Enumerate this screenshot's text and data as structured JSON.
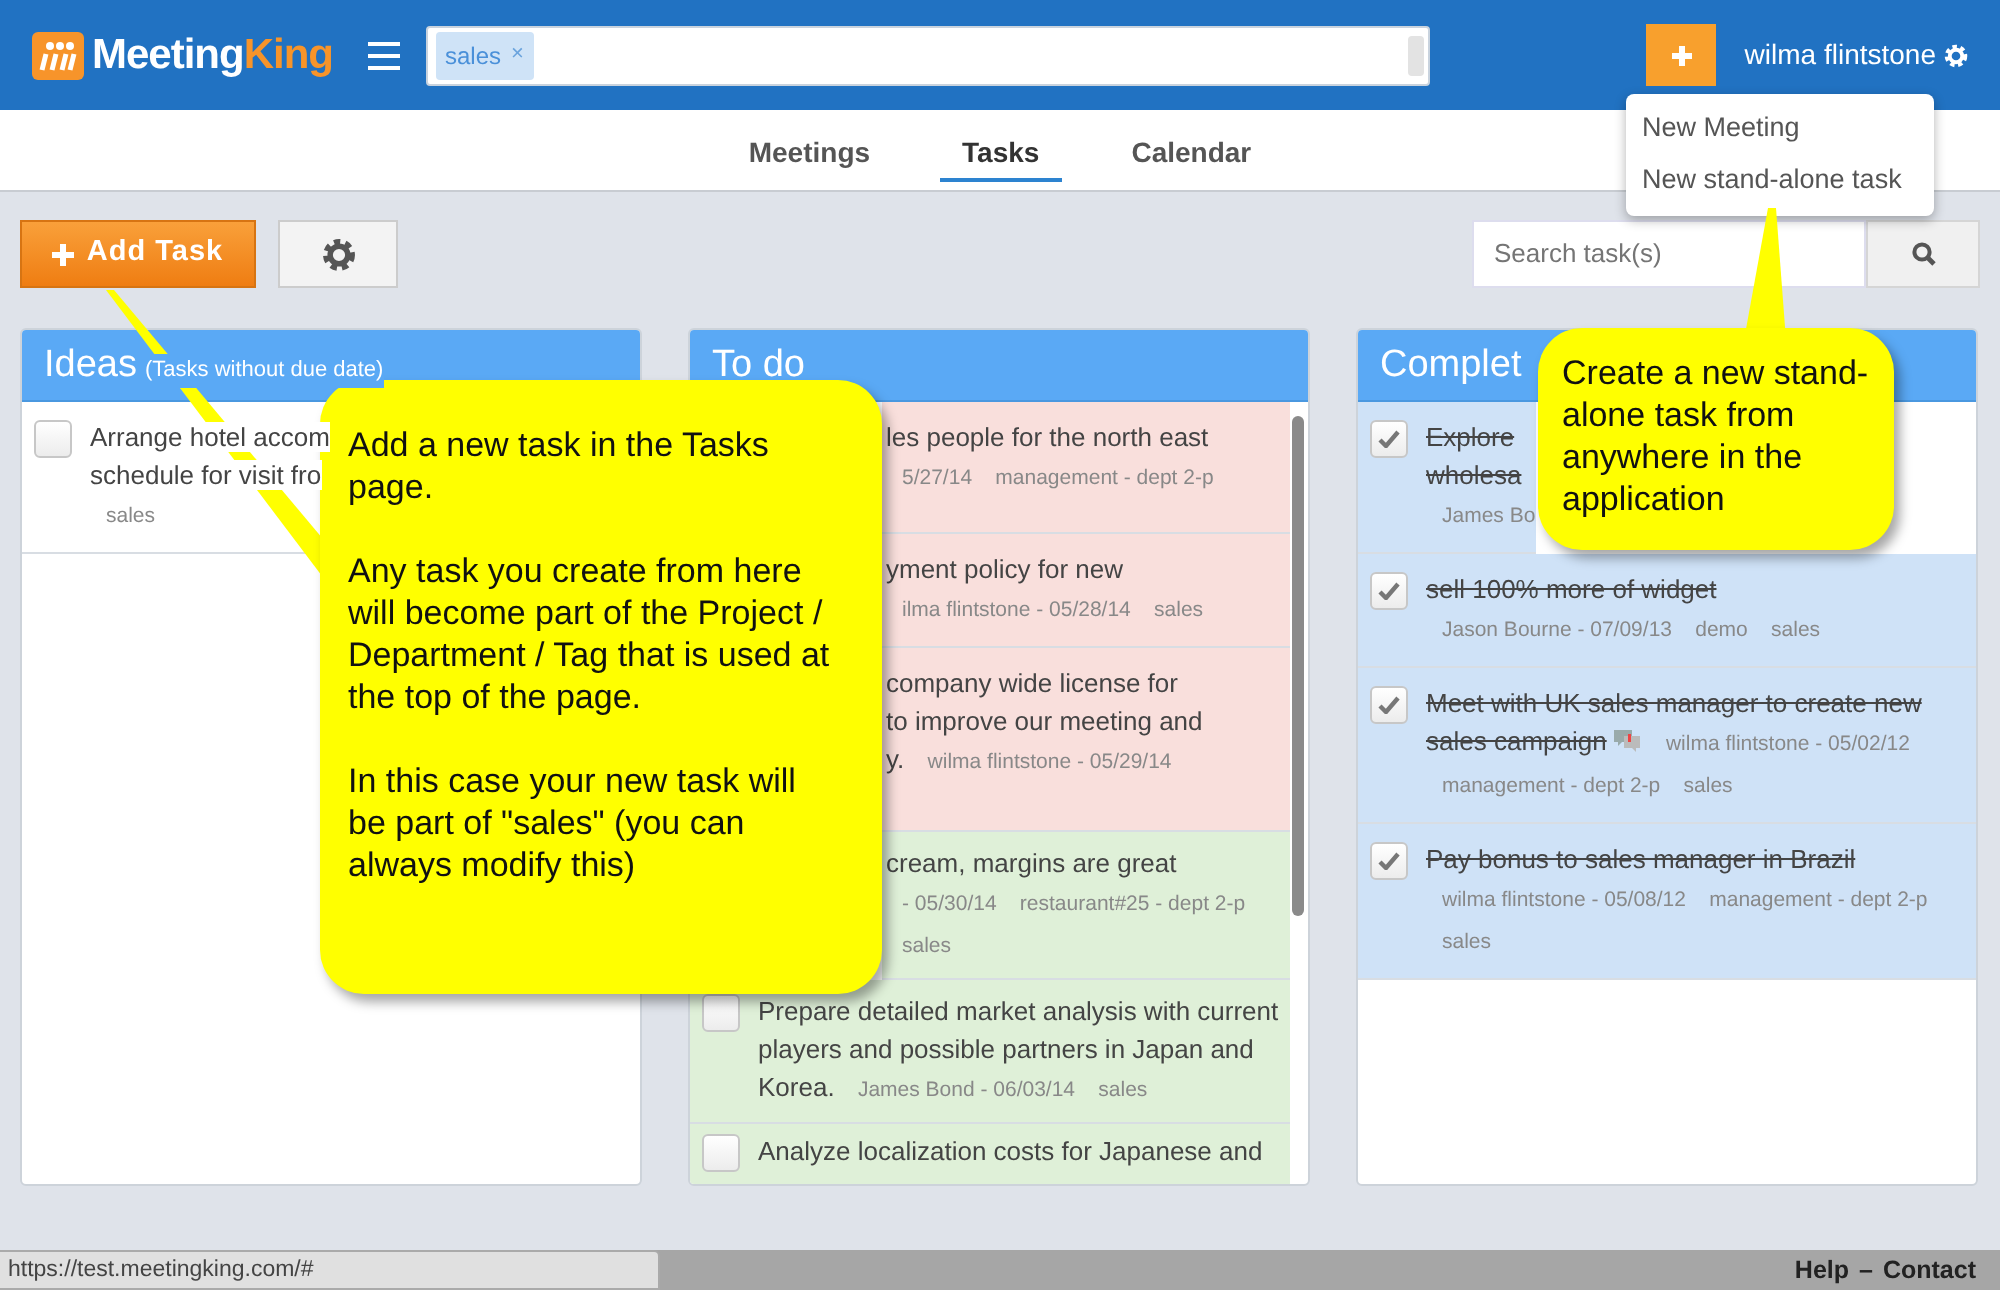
{
  "header": {
    "logo": {
      "part1": "Meeting",
      "part2": "King"
    },
    "tag_filter": {
      "tags": [
        {
          "label": "sales",
          "remove": "×"
        }
      ]
    },
    "user": "wilma flintstone"
  },
  "new_menu": {
    "items": [
      "New Meeting",
      "New stand-alone task"
    ]
  },
  "tabs": [
    {
      "label": "Meetings",
      "selected": false
    },
    {
      "label": "Tasks",
      "selected": true
    },
    {
      "label": "Calendar",
      "selected": false
    }
  ],
  "toolbar": {
    "add_button": "Add Task",
    "search": {
      "placeholder": "Search task(s)"
    }
  },
  "columns": [
    {
      "title": "Ideas",
      "subtitle": "(Tasks without due date)",
      "tasks": [
        {
          "title_lines": [
            "Arrange hotel accom",
            "schedule for visit fro"
          ],
          "checked": false,
          "meta": [
            "sales"
          ]
        }
      ]
    },
    {
      "title": "To do",
      "scrollbar": true,
      "tasks": [
        {
          "title_lines": [
            "les people for the north east"
          ],
          "color": "#f9dfdc",
          "meta": [
            "5/27/14",
            "management - dept 2-p"
          ]
        },
        {
          "title_lines": [
            "yment policy for new"
          ],
          "color": "#f9dfdc",
          "meta": [
            "ilma flintstone - 05/28/14",
            "sales"
          ]
        },
        {
          "title_lines": [
            "company wide license for",
            "to improve our meeting and",
            "y."
          ],
          "color": "#f9dfdc",
          "meta": [
            "wilma flintstone - 05/29/14"
          ]
        },
        {
          "title_lines": [
            "cream, margins are great"
          ],
          "color": "#dff0d8",
          "meta": [
            "- 05/30/14",
            "restaurant#25 - dept 2-p",
            "sales"
          ]
        },
        {
          "title_lines": [
            "Prepare detailed market analysis with current",
            "players and possible partners in Japan and",
            "Korea."
          ],
          "checked": false,
          "color": "#dff0d8",
          "meta": [
            "James Bond - 06/03/14",
            "sales"
          ]
        },
        {
          "title_lines": [
            "Analyze localization costs for Japanese and"
          ],
          "checked": false,
          "color": "#dff0d8"
        }
      ]
    },
    {
      "title": "Complet",
      "tasks": [
        {
          "title_lines": [
            "Explore",
            "wholesa"
          ],
          "checked": true,
          "meta": [
            "James Bo"
          ]
        },
        {
          "title_lines": [
            "sell 100% more of widget"
          ],
          "checked": true,
          "meta": [
            "Jason Bourne - 07/09/13",
            "demo",
            "sales"
          ]
        },
        {
          "title_lines": [
            "Meet with UK sales manager to create new",
            "sales campaign"
          ],
          "checked": true,
          "comments": true,
          "meta": [
            "wilma flintstone - 05/02/12",
            "management - dept 2-p",
            "sales"
          ]
        },
        {
          "title_lines": [
            "Pay bonus to sales manager in Brazil"
          ],
          "checked": true,
          "meta": [
            "wilma flintstone - 05/08/12",
            "management - dept 2-p",
            "sales"
          ]
        }
      ]
    }
  ],
  "callouts": [
    {
      "paragraphs": [
        "Add a new task in the Tasks page.",
        "Any task you create from here will become part of the Project / Department / Tag that is used at the top of the page.",
        "In this case your new task will be part of \"sales\" (you can always modify this)"
      ]
    },
    {
      "paragraphs": [
        "Create a new stand-alone task from anywhere in the application"
      ]
    }
  ],
  "status_url": "https://test.meetingking.com/#",
  "footer": {
    "links": [
      "Help",
      "Contact"
    ],
    "separator": "–"
  }
}
